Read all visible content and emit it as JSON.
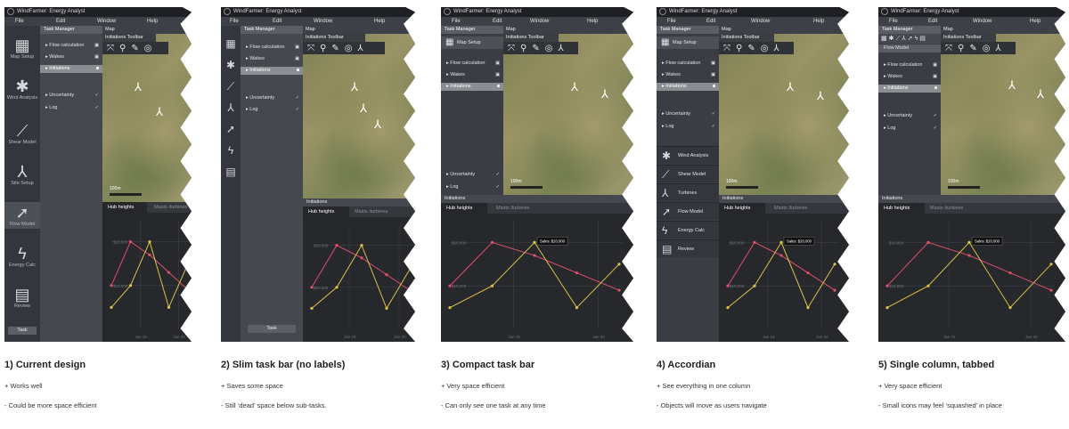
{
  "app": {
    "title": "WindFarmer: Energy Analyst",
    "menus": [
      "File",
      "Edit",
      "Window",
      "Help"
    ]
  },
  "labels": {
    "task_manager": "Task Manager",
    "map": "Map",
    "initiations_toolbar": "Initiations Toolbar",
    "initiations": "Initiations",
    "scale": "100m",
    "task": "Task",
    "tab_hub": "Hub heights",
    "tab_masts": "Masts /turbines",
    "map_setup": "Map Setup",
    "flow_model": "Flow Model"
  },
  "tasks": {
    "flow": "Flow calculation",
    "wakes": "Wakes",
    "initiations": "Initiations",
    "uncertainty": "Uncertainty",
    "log": "Log"
  },
  "sidebar_full": [
    "Map Setup",
    "Wind Analysis",
    "Shear Model",
    "Site Setup",
    "Flow Model",
    "Energy Calc",
    "Review"
  ],
  "accordion": [
    "Wind Analysis",
    "Shear Model",
    "Turbines",
    "Flow Model",
    "Energy Calc",
    "Review"
  ],
  "chart_data": {
    "type": "line",
    "y_ticks": [
      "$20,000",
      "$10,000"
    ],
    "x_ticks": [
      "Jan 15",
      "Jan 20"
    ],
    "tooltip": "Sales: $20,000",
    "series": [
      {
        "values": [
          10,
          20,
          17,
          13,
          9
        ],
        "color": "#e0506a"
      },
      {
        "values": [
          5,
          10,
          20,
          5,
          15
        ],
        "color": "#d9c34a"
      }
    ],
    "ylim": [
      0,
      25
    ]
  },
  "captions": [
    {
      "title": "1) Current design",
      "pro": "+ Works well",
      "con": "- Could be more space efficient"
    },
    {
      "title": "2) Slim task bar (no labels)",
      "pro": "+ Saves some space",
      "con": "- Still ‘dead’ space below sub-tasks."
    },
    {
      "title": "3) Compact task bar",
      "pro": "+ Very space efficient",
      "con": "- Can only see one task at any time"
    },
    {
      "title": "4) Accordian",
      "pro": "+ See everything in one column",
      "con": "- Objects will move as users navigate"
    },
    {
      "title": "5) Single column, tabbed",
      "pro": "+ Very space efficient",
      "con": "- Small icons may feel ‘squashed’ in place"
    }
  ]
}
